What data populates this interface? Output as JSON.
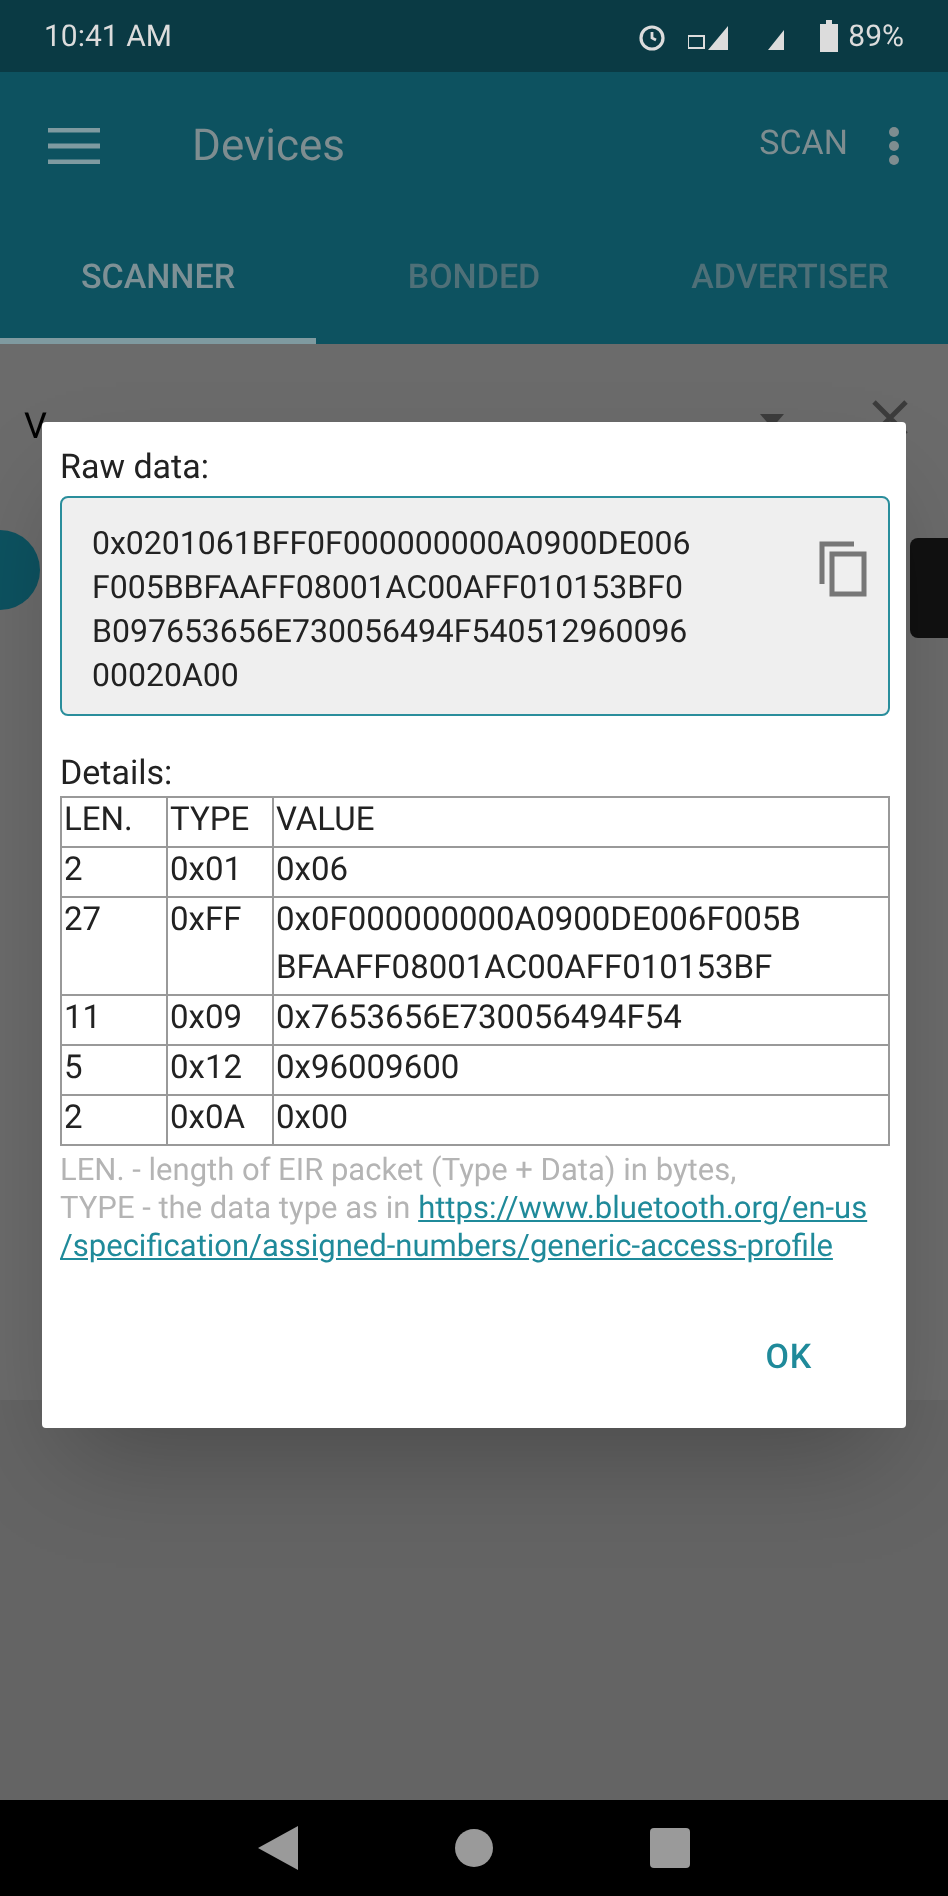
{
  "status_bar": {
    "time": "10:41 AM",
    "battery": "89%"
  },
  "toolbar": {
    "title": "Devices",
    "action": "SCAN"
  },
  "tabs": [
    {
      "label": "SCANNER",
      "selected": true
    },
    {
      "label": "BONDED",
      "selected": false
    },
    {
      "label": "ADVERTISER",
      "selected": false
    }
  ],
  "filter": {
    "value": "V"
  },
  "dialog": {
    "raw_label": "Raw data:",
    "raw_data": [
      "0x0201061BFF0F000000000A0900DE006",
      "F005BBFAAFF08001AC00AFF010153BF0",
      "B097653656E730056494F540512960096",
      "00020A00"
    ],
    "details_label": "Details:",
    "columns": [
      "LEN.",
      "TYPE",
      "VALUE"
    ],
    "rows": [
      {
        "len": "2",
        "type": "0x01",
        "value": "0x06"
      },
      {
        "len": "27",
        "type": "0xFF",
        "value": "0x0F000000000A0900DE006F005B BFAAFF08001AC00AFF010153BF"
      },
      {
        "len": "11",
        "type": "0x09",
        "value": "0x7653656E730056494F54"
      },
      {
        "len": "5",
        "type": "0x12",
        "value": "0x96009600"
      },
      {
        "len": "2",
        "type": "0x0A",
        "value": "0x00"
      }
    ],
    "note_line": "LEN. - length of EIR packet (Type + Data) in bytes,",
    "note_prefix": "TYPE - the data type as in",
    "note_link": "https://www.bluetooth.org/en-us /specification/assigned-numbers/generic-access-profile",
    "ok": "OK"
  }
}
